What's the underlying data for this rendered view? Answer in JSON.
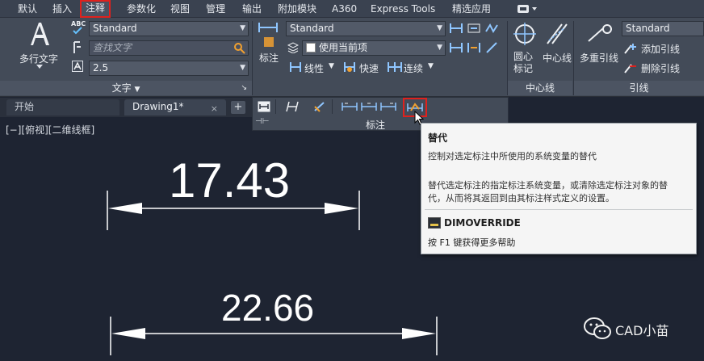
{
  "ribbon_tabs": {
    "default": "默认",
    "insert": "插入",
    "annotate": "注释",
    "parametric": "参数化",
    "view": "视图",
    "manage": "管理",
    "output": "输出",
    "addins": "附加模块",
    "a360": "A360",
    "express": "Express Tools",
    "featured": "精选应用"
  },
  "text_panel": {
    "mtext_label": "多行文字",
    "style_combo": "Standard",
    "find_placeholder": "查找文字",
    "height_combo": "2.5",
    "panel_title": "文字",
    "abc_label": "ABC"
  },
  "dimension_panel": {
    "dim_label": "标注",
    "style_combo": "Standard",
    "layer_combo": "使用当前项",
    "linear": "线性",
    "quick": "快速",
    "continue": "连续",
    "panel_title": "标注"
  },
  "centerline_panel": {
    "center_mark": "圆心\n标记",
    "centerline": "中心线",
    "panel_title": "中心线"
  },
  "leader_panel": {
    "mleader": "多重引线",
    "style_combo": "Standard",
    "add_leader": "添加引线",
    "remove_leader": "删除引线",
    "panel_title": "引线"
  },
  "doc_tabs": {
    "start": "开始",
    "drawing": "Drawing1*",
    "close": "×",
    "new": "+"
  },
  "viewport_label": "[−][俯视][二维线框]",
  "dimensions": {
    "top_value": "17.43",
    "bottom_value": "22.66"
  },
  "tooltip": {
    "title": "替代",
    "summary": "控制对选定标注中所使用的系统变量的替代",
    "detail_line1": "替代选定标注的指定标注系统变量，或清除选定标注对象的替",
    "detail_line2": "代，从而将其返回到由其标注样式定义的设置。",
    "command": "DIMOVERRIDE",
    "help": "按 F1 键获得更多帮助"
  },
  "watermark": "CAD小苗",
  "colors": {
    "highlight": "#e0211d",
    "canvas": "#1e2432",
    "ribbon": "#434b58"
  }
}
